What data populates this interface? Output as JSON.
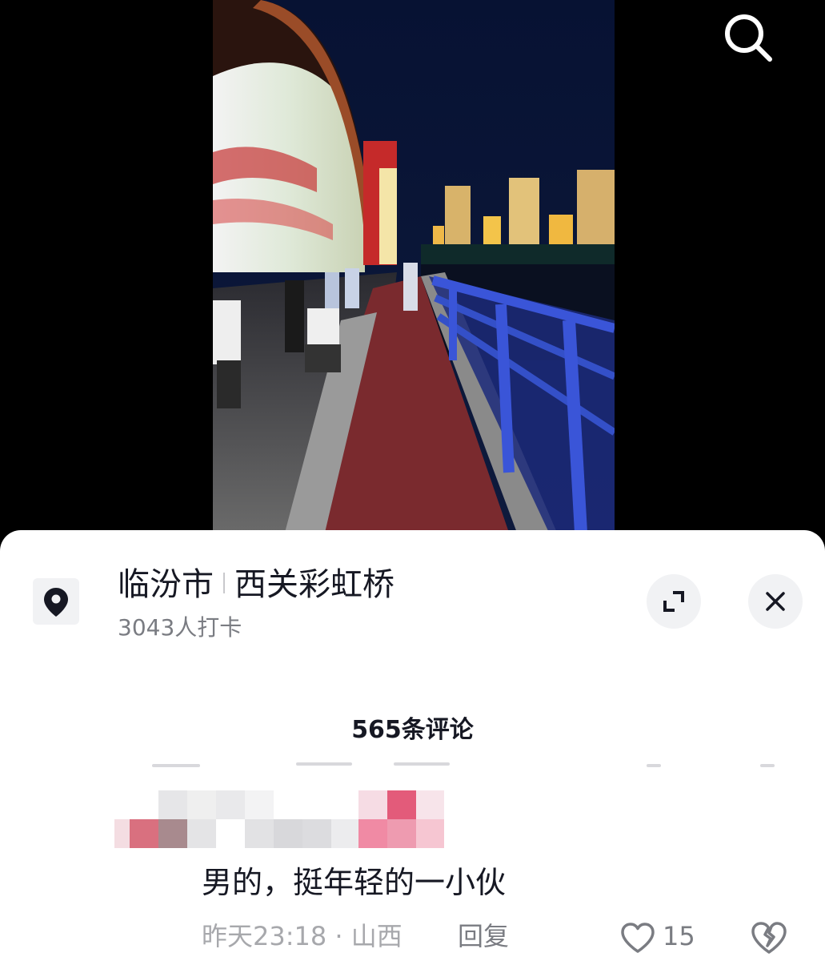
{
  "poi": {
    "city": "临汾市",
    "place": "西关彩虹桥",
    "checkins": "3043人打卡"
  },
  "comments": {
    "count_label": "565条评论",
    "items": [
      {
        "text": "男的，挺年轻的一小伙",
        "time": "昨天23:18",
        "dot": "·",
        "location": "山西",
        "reply_label": "回复",
        "likes": "15"
      }
    ]
  },
  "icons": {
    "search": "search-icon",
    "location": "location-pin-icon",
    "expand": "expand-icon",
    "close": "close-icon",
    "like": "heart-outline-icon",
    "dislike": "broken-heart-icon"
  },
  "colors": {
    "sheet_bg": "#ffffff",
    "primary_text": "#161823",
    "secondary_text": "#7a7c82",
    "button_bg": "#f1f2f4"
  }
}
